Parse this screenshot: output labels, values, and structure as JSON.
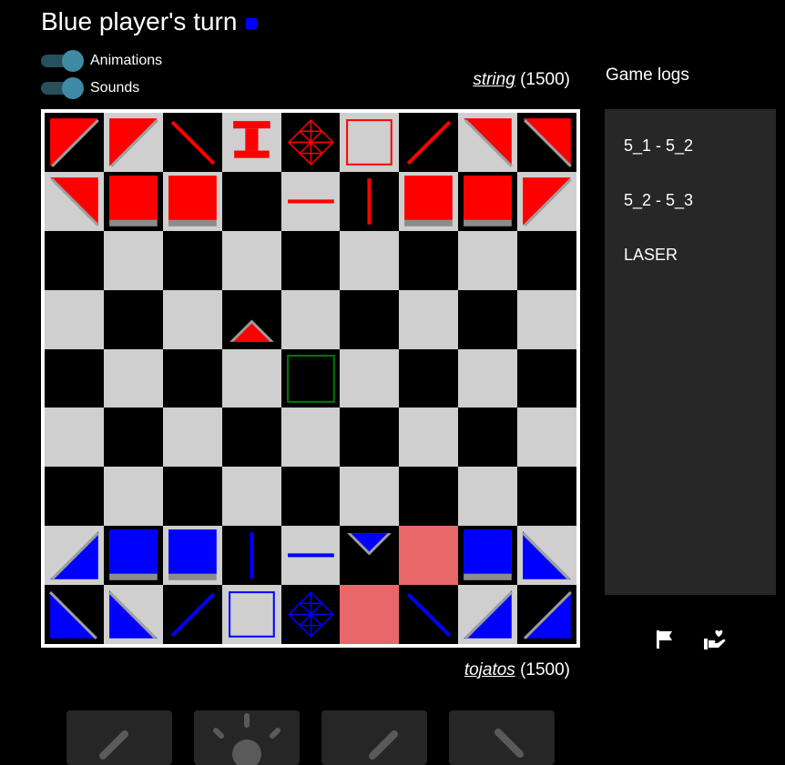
{
  "header": {
    "title": "Blue player's turn",
    "turn_color": "#0000ff"
  },
  "settings": {
    "animations": {
      "label": "Animations",
      "on": true
    },
    "sounds": {
      "label": "Sounds",
      "on": true
    }
  },
  "players": {
    "top": {
      "name": "string",
      "rating": "(1500)"
    },
    "bottom": {
      "name": "tojatos",
      "rating": "(1500)"
    }
  },
  "logs": {
    "title": "Game logs",
    "entries": [
      "5_1 - 5_2",
      "5_2 - 5_3",
      "LASER"
    ]
  },
  "colors": {
    "light_square": "#cfcfcf",
    "dark_square": "#000000",
    "red": "#ff0000",
    "blue": "#0000ff",
    "highlight_square": "#e8686a",
    "target_outline": "#007a00",
    "panel": "#272727",
    "toggle_knob": "#3f8aa4"
  },
  "board": {
    "size": 9,
    "pieces": [
      {
        "row": 0,
        "col": 0,
        "color": "red",
        "type": "mirror",
        "dir": "tl"
      },
      {
        "row": 0,
        "col": 1,
        "color": "red",
        "type": "mirror",
        "dir": "tl"
      },
      {
        "row": 0,
        "col": 2,
        "color": "red",
        "type": "line",
        "dir": "back"
      },
      {
        "row": 0,
        "col": 3,
        "color": "red",
        "type": "tower"
      },
      {
        "row": 0,
        "col": 4,
        "color": "red",
        "type": "king"
      },
      {
        "row": 0,
        "col": 5,
        "color": "red",
        "type": "outline"
      },
      {
        "row": 0,
        "col": 6,
        "color": "red",
        "type": "line",
        "dir": "fwd"
      },
      {
        "row": 0,
        "col": 7,
        "color": "red",
        "type": "mirror",
        "dir": "tr"
      },
      {
        "row": 0,
        "col": 8,
        "color": "red",
        "type": "mirror",
        "dir": "tr"
      },
      {
        "row": 1,
        "col": 0,
        "color": "red",
        "type": "mirror",
        "dir": "tr"
      },
      {
        "row": 1,
        "col": 1,
        "color": "red",
        "type": "block"
      },
      {
        "row": 1,
        "col": 2,
        "color": "red",
        "type": "block"
      },
      {
        "row": 1,
        "col": 4,
        "color": "red",
        "type": "line",
        "dir": "h"
      },
      {
        "row": 1,
        "col": 5,
        "color": "red",
        "type": "line",
        "dir": "v"
      },
      {
        "row": 1,
        "col": 6,
        "color": "red",
        "type": "block"
      },
      {
        "row": 1,
        "col": 7,
        "color": "red",
        "type": "block"
      },
      {
        "row": 1,
        "col": 8,
        "color": "red",
        "type": "mirror",
        "dir": "tl"
      },
      {
        "row": 3,
        "col": 3,
        "color": "red",
        "type": "triangle",
        "dir": "up"
      },
      {
        "row": 4,
        "col": 4,
        "color": "green",
        "type": "target"
      },
      {
        "row": 7,
        "col": 0,
        "color": "blue",
        "type": "mirror",
        "dir": "br"
      },
      {
        "row": 7,
        "col": 1,
        "color": "blue",
        "type": "block"
      },
      {
        "row": 7,
        "col": 2,
        "color": "blue",
        "type": "block"
      },
      {
        "row": 7,
        "col": 3,
        "color": "blue",
        "type": "line",
        "dir": "v"
      },
      {
        "row": 7,
        "col": 4,
        "color": "blue",
        "type": "line",
        "dir": "h"
      },
      {
        "row": 7,
        "col": 5,
        "color": "blue",
        "type": "triangle",
        "dir": "down"
      },
      {
        "row": 7,
        "col": 6,
        "color": "none",
        "type": "highlight"
      },
      {
        "row": 7,
        "col": 7,
        "color": "blue",
        "type": "block"
      },
      {
        "row": 7,
        "col": 8,
        "color": "blue",
        "type": "mirror",
        "dir": "bl"
      },
      {
        "row": 8,
        "col": 0,
        "color": "blue",
        "type": "mirror",
        "dir": "bl"
      },
      {
        "row": 8,
        "col": 1,
        "color": "blue",
        "type": "mirror",
        "dir": "bl"
      },
      {
        "row": 8,
        "col": 2,
        "color": "blue",
        "type": "line",
        "dir": "fwd"
      },
      {
        "row": 8,
        "col": 3,
        "color": "blue",
        "type": "outline"
      },
      {
        "row": 8,
        "col": 4,
        "color": "blue",
        "type": "king"
      },
      {
        "row": 8,
        "col": 5,
        "color": "none",
        "type": "highlight"
      },
      {
        "row": 8,
        "col": 6,
        "color": "blue",
        "type": "line",
        "dir": "back"
      },
      {
        "row": 8,
        "col": 7,
        "color": "blue",
        "type": "mirror",
        "dir": "br"
      },
      {
        "row": 8,
        "col": 8,
        "color": "blue",
        "type": "mirror",
        "dir": "br"
      }
    ]
  },
  "actions": {
    "surrender_icon": "flag-icon",
    "draw_icon": "hand-heart-icon",
    "buttons": [
      {
        "name": "rotate-left-button",
        "icon": "rotate-left-icon"
      },
      {
        "name": "laser-button",
        "icon": "sun-icon"
      },
      {
        "name": "rotate-right-button",
        "icon": "rotate-right-icon"
      },
      {
        "name": "rotate-other-button",
        "icon": "rotate-other-icon"
      }
    ]
  }
}
